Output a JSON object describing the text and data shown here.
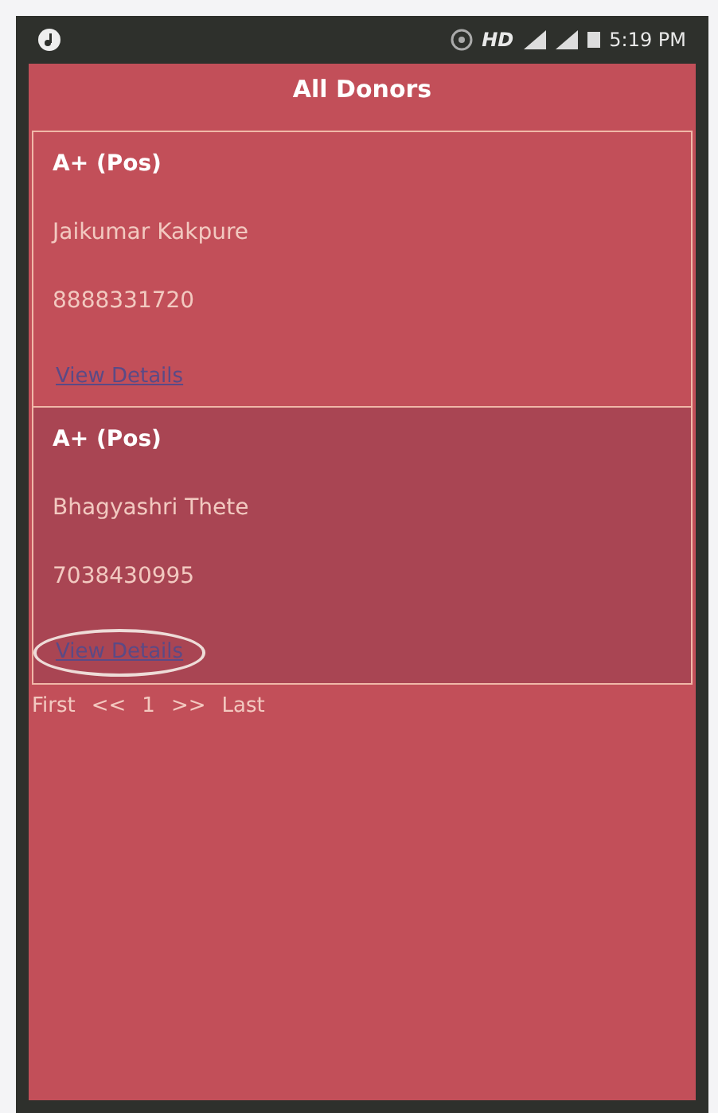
{
  "status_bar": {
    "time": "5:19 PM",
    "network": "HD"
  },
  "title": "All Donors",
  "donors": [
    {
      "blood_group": "A+ (Pos)",
      "name": "Jaikumar Kakpure",
      "phone": "8888331720",
      "link": "View Details",
      "selected": false,
      "circled": false
    },
    {
      "blood_group": "A+ (Pos)",
      "name": "Bhagyashri Thete",
      "phone": "7038430995",
      "link": "View Details",
      "selected": true,
      "circled": true
    }
  ],
  "pager": [
    "First",
    "<<",
    "1",
    ">>",
    "Last"
  ]
}
